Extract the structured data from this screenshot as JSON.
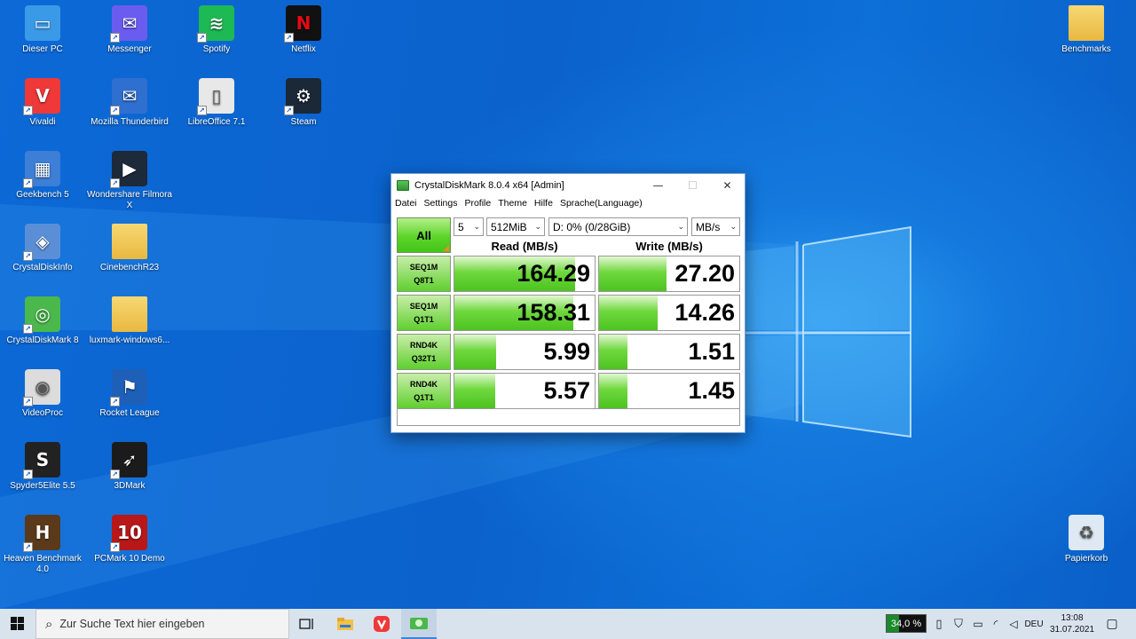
{
  "desktop": {
    "icons": [
      {
        "label": "Dieser PC",
        "icon": "this-pc-icon",
        "shortcut": false
      },
      {
        "label": "Messenger",
        "icon": "messenger-icon",
        "shortcut": true
      },
      {
        "label": "Spotify",
        "icon": "spotify-icon",
        "shortcut": true
      },
      {
        "label": "Netflix",
        "icon": "netflix-icon",
        "shortcut": true
      },
      {
        "label": "Vivaldi",
        "icon": "vivaldi-icon",
        "shortcut": true
      },
      {
        "label": "Mozilla Thunderbird",
        "icon": "thunderbird-icon",
        "shortcut": true
      },
      {
        "label": "LibreOffice 7.1",
        "icon": "libreoffice-icon",
        "shortcut": true
      },
      {
        "label": "Steam",
        "icon": "steam-icon",
        "shortcut": true
      },
      {
        "label": "Geekbench 5",
        "icon": "geekbench-icon",
        "shortcut": true
      },
      {
        "label": "Wondershare Filmora X",
        "icon": "filmora-icon",
        "shortcut": true
      },
      {
        "label": "CrystalDiskInfo",
        "icon": "crystaldiskinfo-icon",
        "shortcut": true
      },
      {
        "label": "CinebenchR23",
        "icon": "folder-icon",
        "shortcut": false
      },
      {
        "label": "CrystalDiskMark 8",
        "icon": "crystaldiskmark-icon",
        "shortcut": true
      },
      {
        "label": "luxmark-windows6...",
        "icon": "folder-icon",
        "shortcut": false
      },
      {
        "label": "VideoProc",
        "icon": "videoproc-icon",
        "shortcut": true
      },
      {
        "label": "Rocket League",
        "icon": "rocket-league-icon",
        "shortcut": true
      },
      {
        "label": "Spyder5Elite 5.5",
        "icon": "spyder-icon",
        "shortcut": true
      },
      {
        "label": "3DMark",
        "icon": "3dmark-icon",
        "shortcut": true
      },
      {
        "label": "Heaven Benchmark 4.0",
        "icon": "heaven-icon",
        "shortcut": true
      },
      {
        "label": "PCMark 10 Demo",
        "icon": "pcmark-icon",
        "shortcut": true
      },
      {
        "label": "Benchmarks",
        "icon": "folder-icon",
        "shortcut": false
      },
      {
        "label": "Papierkorb",
        "icon": "recycle-bin-icon",
        "shortcut": false
      }
    ]
  },
  "window": {
    "title": "CrystalDiskMark 8.0.4 x64 [Admin]",
    "minimize": "—",
    "maximize": "☐",
    "close": "✕",
    "menu": [
      "Datei",
      "Settings",
      "Profile",
      "Theme",
      "Hilfe",
      "Sprache(Language)"
    ],
    "all_button": "All",
    "count": "5",
    "size": "512MiB",
    "drive": "D: 0% (0/28GiB)",
    "unit": "MB/s",
    "read_header": "Read (MB/s)",
    "write_header": "Write (MB/s)",
    "tests": [
      {
        "line1": "SEQ1M",
        "line2": "Q8T1",
        "read": "164.29",
        "write": "27.20",
        "read_fill": 0.86,
        "write_fill": 0.48
      },
      {
        "line1": "SEQ1M",
        "line2": "Q1T1",
        "read": "158.31",
        "write": "14.26",
        "read_fill": 0.85,
        "write_fill": 0.42
      },
      {
        "line1": "RND4K",
        "line2": "Q32T1",
        "read": "5.99",
        "write": "1.51",
        "read_fill": 0.3,
        "write_fill": 0.2
      },
      {
        "line1": "RND4K",
        "line2": "Q1T1",
        "read": "5.57",
        "write": "1.45",
        "read_fill": 0.29,
        "write_fill": 0.2
      }
    ],
    "comment": ""
  },
  "taskbar": {
    "search_placeholder": "Zur Suche Text hier eingeben",
    "perf": "34,0 %",
    "lang": "DEU",
    "time": "13:08",
    "date": "31.07.2021"
  }
}
